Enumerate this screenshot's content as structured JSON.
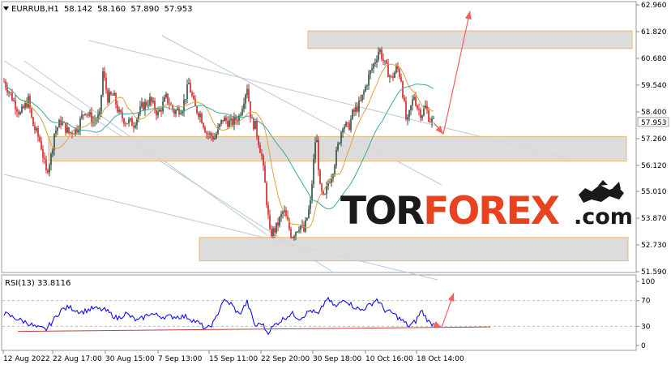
{
  "symbol_header": {
    "symbol": "EURRUB,H1",
    "open": "58.142",
    "high": "58.160",
    "low": "57.890",
    "close": "57.953"
  },
  "price_axis": {
    "ticks": [
      "62.960",
      "61.820",
      "60.680",
      "59.540",
      "58.400",
      "57.260",
      "56.120",
      "55.010",
      "53.870",
      "52.730",
      "51.590"
    ],
    "current_price": "57.953",
    "ylim": [
      51.59,
      62.96
    ]
  },
  "rsi_panel": {
    "title": "RSI(13) 33.8116",
    "ticks": [
      "100",
      "70",
      "30",
      "0"
    ],
    "levels": [
      70,
      30
    ]
  },
  "time_axis": {
    "labels": [
      "12 Aug 2022",
      "22 Aug 17:00",
      "30 Aug 15:00",
      "7 Sep 13:00",
      "15 Sep 11:00",
      "22 Sep 20:00",
      "30 Sep 18:00",
      "10 Oct 16:00",
      "18 Oct 14:00"
    ]
  },
  "watermark": {
    "part1": "TOR",
    "part2": "FOREX",
    "suffix": ".com",
    "color_dark": "#1a1a1a",
    "color_red": "#e8421e"
  },
  "colors": {
    "bull_candle": "#2e4a3a",
    "bear_candle": "#d42020",
    "ma_fast": "#e0a040",
    "ma_slow": "#3aa8a0",
    "rsi_line": "#1010ee",
    "zone_fill": "#d8d8d8",
    "zone_border": "#e8b870",
    "forecast_arrow": "#f26060",
    "trend_lines": "#b8c8d8"
  },
  "chart_data": [
    {
      "type": "candlestick",
      "title": "EURRUB,H1",
      "ylim": [
        51.59,
        62.96
      ],
      "x_tick_labels": [
        "12 Aug 2022",
        "22 Aug 17:00",
        "30 Aug 15:00",
        "7 Sep 13:00",
        "15 Sep 11:00",
        "22 Sep 20:00",
        "30 Sep 18:00",
        "10 Oct 16:00",
        "18 Oct 14:00"
      ],
      "path_anchors": [
        [
          0,
          59.7
        ],
        [
          10,
          59.0
        ],
        [
          20,
          58.3
        ],
        [
          30,
          58.9
        ],
        [
          35,
          57.9
        ],
        [
          45,
          57.1
        ],
        [
          52,
          55.8
        ],
        [
          58,
          56.5
        ],
        [
          62,
          57.5
        ],
        [
          70,
          58.0
        ],
        [
          80,
          57.5
        ],
        [
          90,
          57.7
        ],
        [
          100,
          58.5
        ],
        [
          110,
          58.0
        ],
        [
          118,
          58.2
        ],
        [
          122,
          60.1
        ],
        [
          128,
          59.0
        ],
        [
          135,
          59.1
        ],
        [
          142,
          58.3
        ],
        [
          150,
          58.0
        ],
        [
          160,
          57.9
        ],
        [
          170,
          58.6
        ],
        [
          180,
          58.9
        ],
        [
          190,
          58.3
        ],
        [
          200,
          59.0
        ],
        [
          210,
          58.4
        ],
        [
          220,
          58.6
        ],
        [
          228,
          59.6
        ],
        [
          235,
          58.6
        ],
        [
          242,
          58.3
        ],
        [
          250,
          57.5
        ],
        [
          260,
          57.3
        ],
        [
          270,
          58.1
        ],
        [
          280,
          57.9
        ],
        [
          290,
          58.2
        ],
        [
          300,
          59.5
        ],
        [
          305,
          58.0
        ],
        [
          310,
          57.8
        ],
        [
          318,
          56.5
        ],
        [
          322,
          55.3
        ],
        [
          328,
          53.2
        ],
        [
          335,
          53.4
        ],
        [
          345,
          54.2
        ],
        [
          355,
          53.1
        ],
        [
          365,
          53.6
        ],
        [
          370,
          53.3
        ],
        [
          378,
          54.5
        ],
        [
          385,
          57.6
        ],
        [
          390,
          55.1
        ],
        [
          395,
          54.6
        ],
        [
          400,
          55.4
        ],
        [
          405,
          55.8
        ],
        [
          410,
          56.6
        ],
        [
          418,
          57.9
        ],
        [
          425,
          57.7
        ],
        [
          430,
          58.3
        ],
        [
          440,
          58.8
        ],
        [
          450,
          59.9
        ],
        [
          458,
          60.6
        ],
        [
          463,
          61.1
        ],
        [
          470,
          60.4
        ],
        [
          478,
          59.8
        ],
        [
          485,
          60.3
        ],
        [
          490,
          59.8
        ],
        [
          497,
          57.8
        ],
        [
          502,
          58.6
        ],
        [
          506,
          59.1
        ],
        [
          510,
          58.6
        ],
        [
          515,
          58.3
        ],
        [
          520,
          58.6
        ],
        [
          525,
          58.1
        ],
        [
          530,
          57.95
        ]
      ],
      "channels": [
        {
          "name": "fast_ma",
          "period_note": "fast moving average"
        },
        {
          "name": "slow_ma",
          "period_note": "slow moving average"
        }
      ],
      "zones": [
        {
          "low": 61.1,
          "high": 61.85
        },
        {
          "low": 56.3,
          "high": 57.35
        },
        {
          "low": 52.05,
          "high": 53.05
        }
      ],
      "forecast": {
        "from": [
          530,
          57.95
        ],
        "via": [
          542,
          57.45
        ],
        "to": [
          575,
          62.7
        ]
      }
    },
    {
      "type": "line",
      "title": "RSI(13) 33.8116",
      "ylim": [
        0,
        100
      ],
      "levels": [
        30,
        70
      ],
      "path_anchors": [
        [
          0,
          50
        ],
        [
          15,
          42
        ],
        [
          30,
          35
        ],
        [
          40,
          28
        ],
        [
          52,
          25
        ],
        [
          60,
          38
        ],
        [
          70,
          55
        ],
        [
          80,
          60
        ],
        [
          95,
          52
        ],
        [
          110,
          58
        ],
        [
          125,
          55
        ],
        [
          140,
          42
        ],
        [
          150,
          50
        ],
        [
          165,
          38
        ],
        [
          180,
          50
        ],
        [
          195,
          45
        ],
        [
          210,
          45
        ],
        [
          225,
          45
        ],
        [
          240,
          35
        ],
        [
          250,
          25
        ],
        [
          260,
          38
        ],
        [
          270,
          70
        ],
        [
          280,
          65
        ],
        [
          290,
          48
        ],
        [
          300,
          68
        ],
        [
          310,
          30
        ],
        [
          318,
          35
        ],
        [
          325,
          20
        ],
        [
          335,
          33
        ],
        [
          345,
          42
        ],
        [
          355,
          50
        ],
        [
          365,
          42
        ],
        [
          378,
          55
        ],
        [
          388,
          48
        ],
        [
          398,
          73
        ],
        [
          410,
          60
        ],
        [
          420,
          73
        ],
        [
          430,
          62
        ],
        [
          440,
          55
        ],
        [
          450,
          62
        ],
        [
          460,
          72
        ],
        [
          470,
          55
        ],
        [
          480,
          50
        ],
        [
          490,
          40
        ],
        [
          500,
          30
        ],
        [
          508,
          38
        ],
        [
          515,
          55
        ],
        [
          520,
          45
        ],
        [
          525,
          35
        ],
        [
          530,
          33.8
        ]
      ],
      "forecast": {
        "from": [
          530,
          33.8
        ],
        "via": [
          540,
          28
        ],
        "to": [
          555,
          82
        ]
      }
    }
  ]
}
